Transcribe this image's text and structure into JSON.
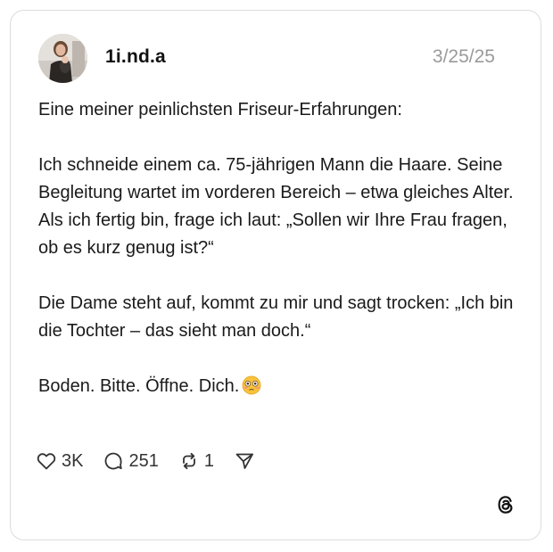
{
  "post": {
    "username": "1i.nd.a",
    "date": "3/25/25",
    "paragraphs": [
      "Eine meiner peinlichsten Friseur-Erfahrungen:",
      "Ich schneide einem ca. 75-jährigen Mann die Haare. Seine Begleitung wartet im vorderen Bereich – etwa gleiches Alter. Als ich fertig bin, frage ich laut: „Sollen wir Ihre Frau fragen, ob es kurz genug ist?“",
      "Die Dame steht auf, kommt zu mir und sagt trocken: „Ich bin die Tochter – das sieht man doch.“"
    ],
    "closing_line": "Boden. Bitte. Öffne. Dich.",
    "closing_emoji": "flushed-face-emoji"
  },
  "actions": {
    "likes": "3K",
    "comments": "251",
    "reposts": "1",
    "like_icon": "heart-icon",
    "comment_icon": "comment-bubble-icon",
    "repost_icon": "repost-icon",
    "share_icon": "send-icon"
  },
  "brand": {
    "logo": "threads-logo-icon"
  }
}
